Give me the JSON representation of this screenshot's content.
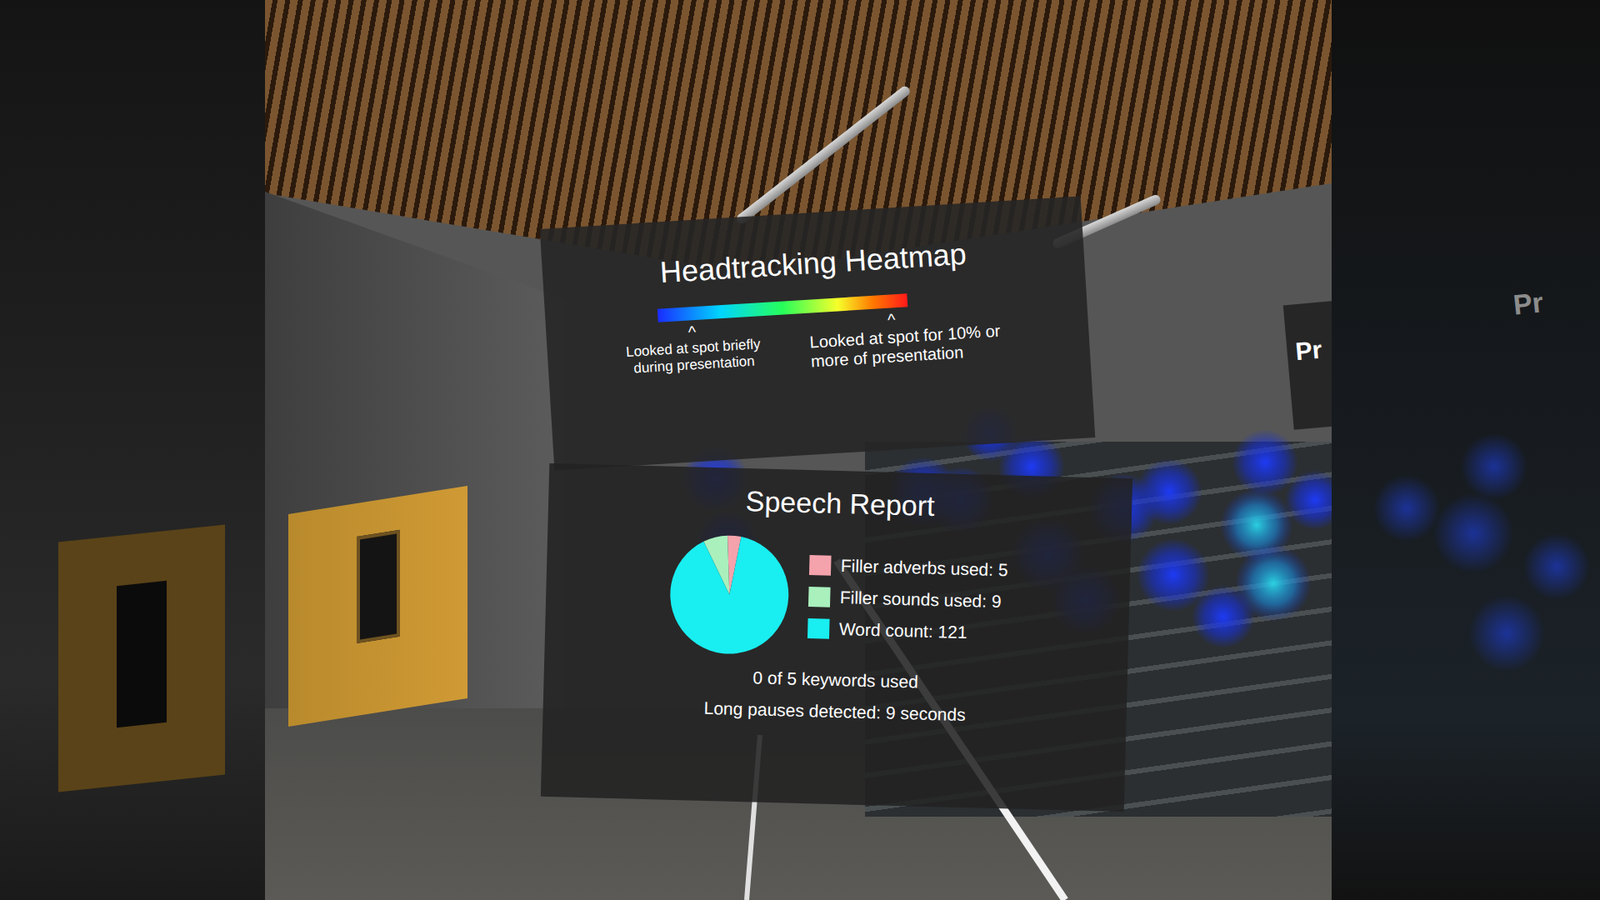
{
  "heatmap_panel": {
    "title": "Headtracking Heatmap",
    "scale": {
      "low_marker": "^",
      "low_label": "Looked at spot briefly during presentation",
      "high_marker": "^",
      "high_label": "Looked at spot for 10% or more of presentation"
    }
  },
  "speech_report": {
    "title": "Speech Report",
    "chart": {
      "series": [
        {
          "label": "Filler adverbs used: 5",
          "value": 5,
          "color": "#f4a3ad"
        },
        {
          "label": "Filler sounds used: 9",
          "value": 9,
          "color": "#a9f0bd"
        },
        {
          "label": "Word count: 121",
          "value": 121,
          "color": "#19eef0"
        }
      ]
    },
    "keywords": "0 of 5 keywords used",
    "pauses": "Long pauses detected: 9 seconds"
  },
  "side_panel": {
    "title": "Pr"
  },
  "mirror_panel": {
    "title": "Pr"
  }
}
